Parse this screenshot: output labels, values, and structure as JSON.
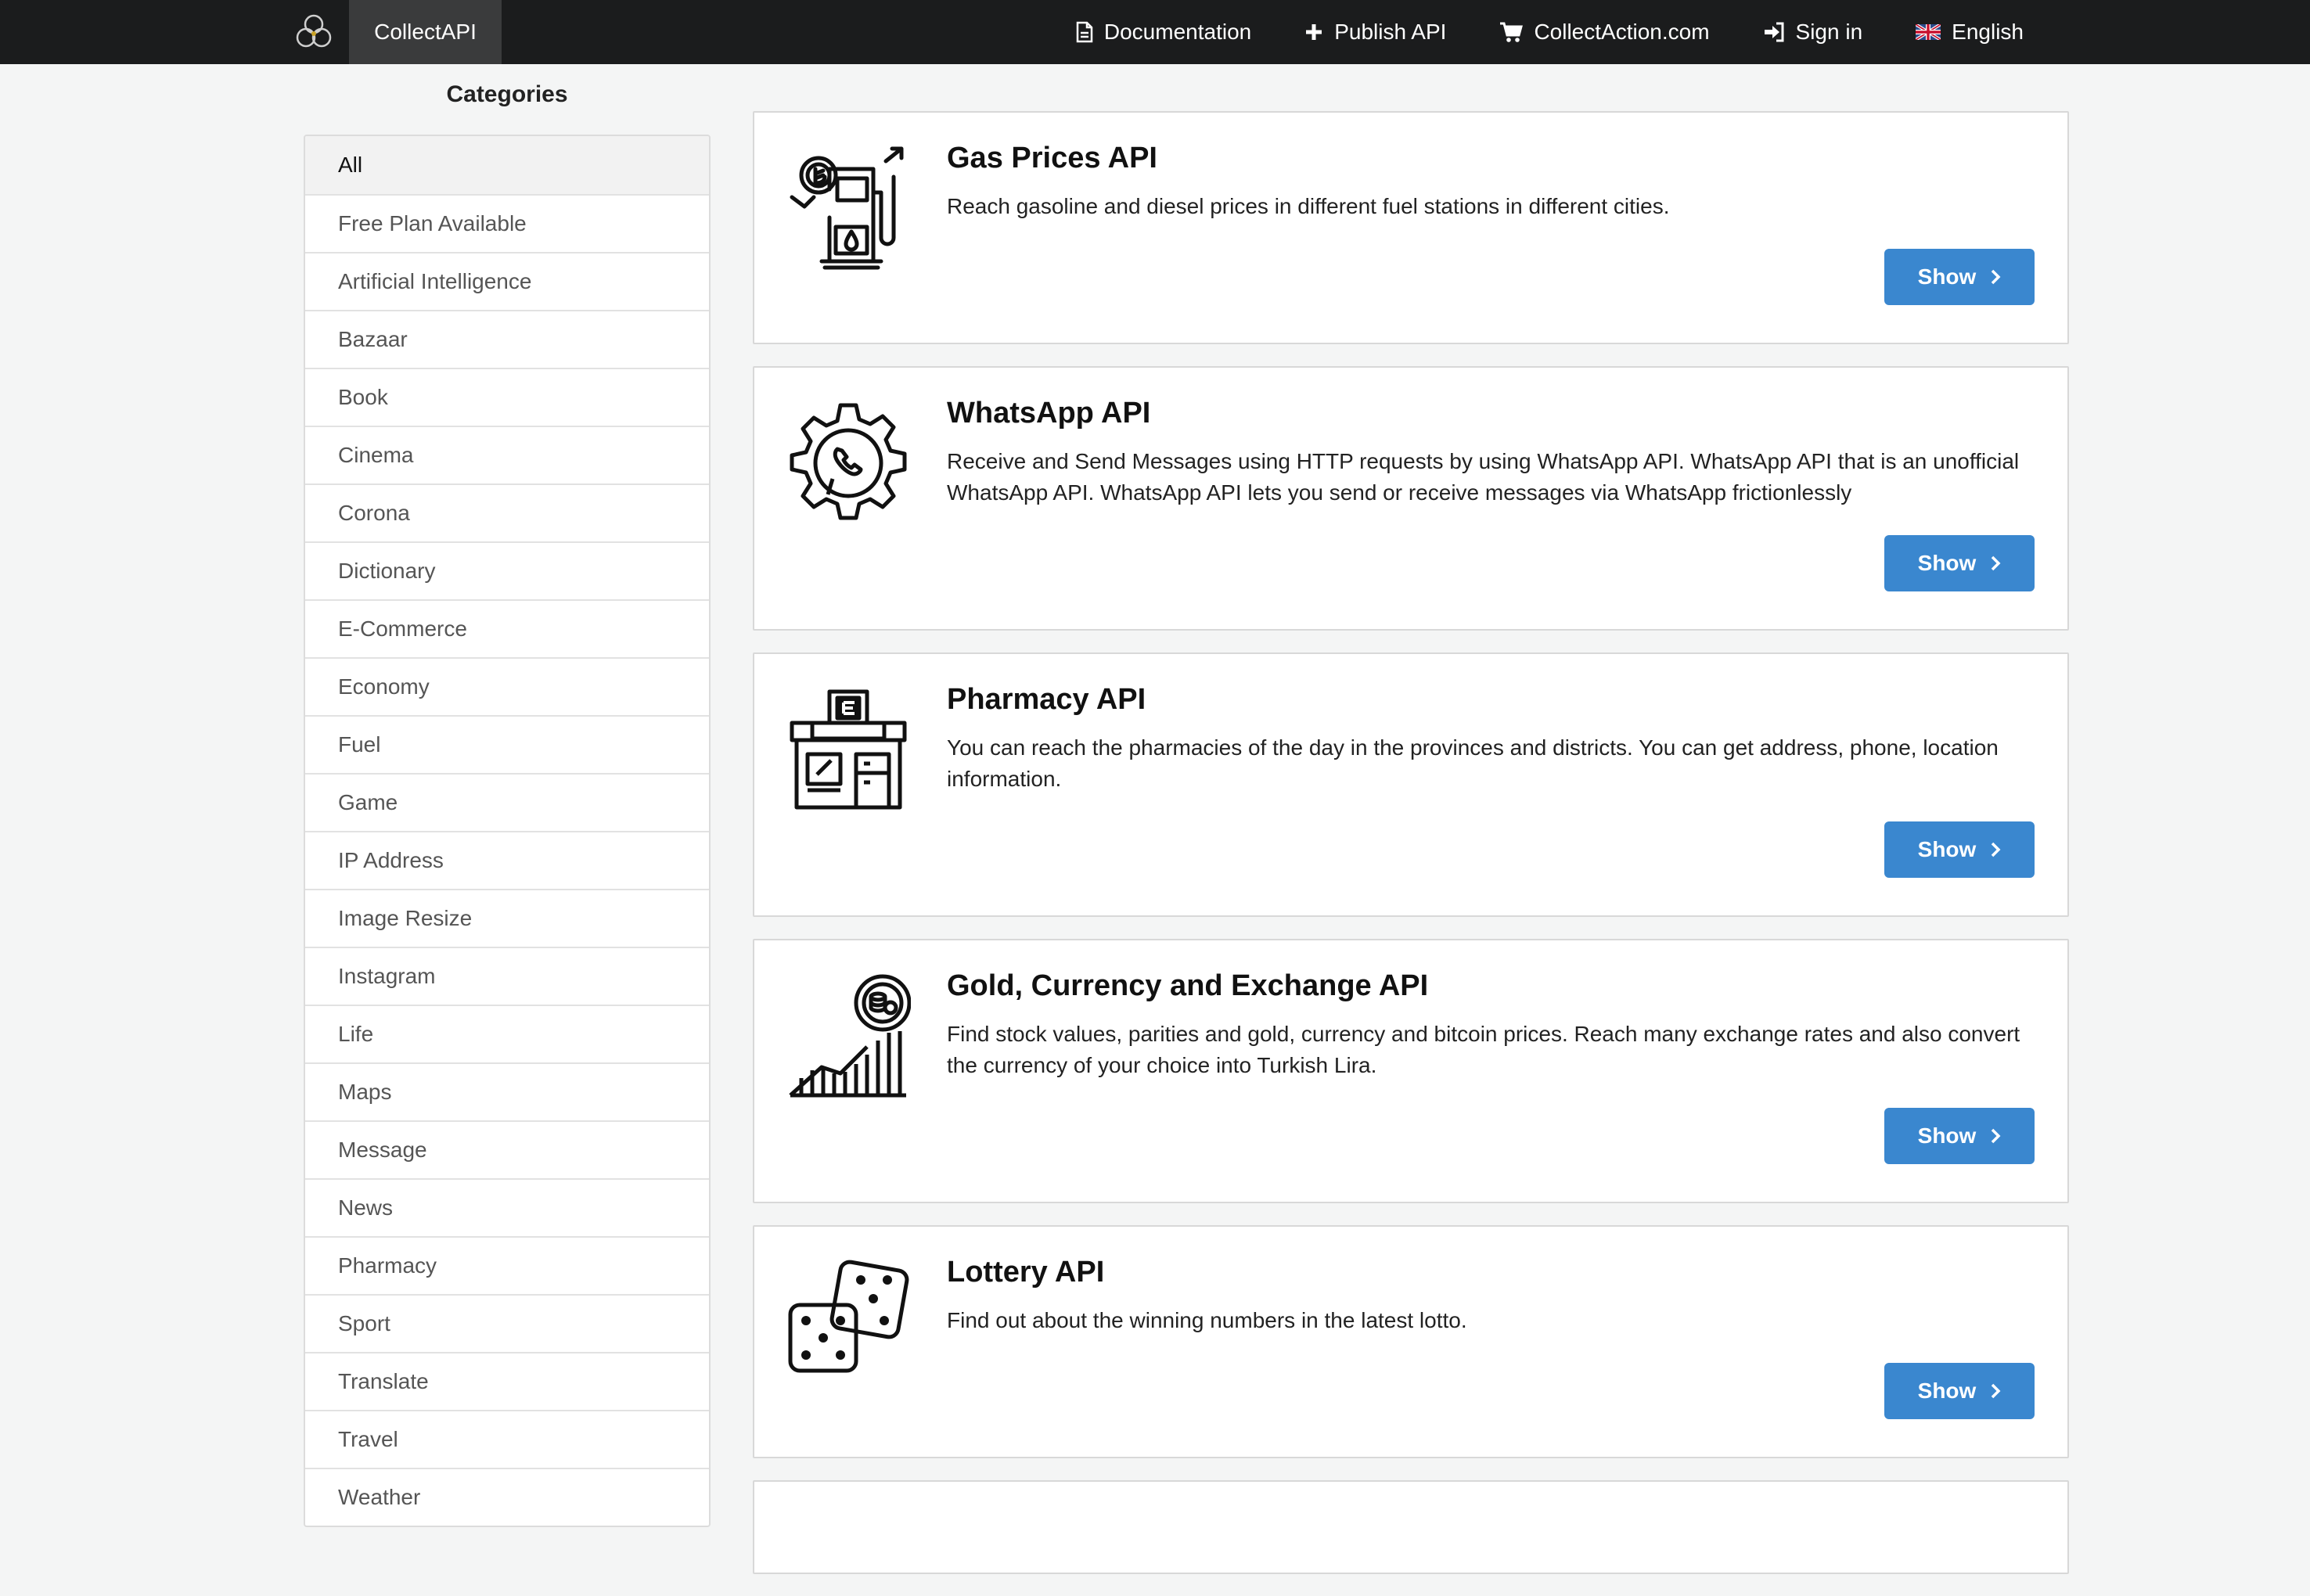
{
  "navbar": {
    "brand": "CollectAPI",
    "items": [
      {
        "label": "Documentation",
        "icon": "document-icon"
      },
      {
        "label": "Publish API",
        "icon": "plus-icon"
      },
      {
        "label": "CollectAction.com",
        "icon": "cart-icon"
      },
      {
        "label": "Sign in",
        "icon": "sign-in-icon"
      },
      {
        "label": "English",
        "icon": "uk-flag-icon"
      }
    ]
  },
  "sidebar": {
    "heading": "Categories",
    "items": [
      "All",
      "Free Plan Available",
      "Artificial Intelligence",
      "Bazaar",
      "Book",
      "Cinema",
      "Corona",
      "Dictionary",
      "E-Commerce",
      "Economy",
      "Fuel",
      "Game",
      "IP Address",
      "Image Resize",
      "Instagram",
      "Life",
      "Maps",
      "Message",
      "News",
      "Pharmacy",
      "Sport",
      "Translate",
      "Travel",
      "Weather"
    ]
  },
  "cards": [
    {
      "title": "Gas Prices API",
      "description": "Reach gasoline and diesel prices in different fuel stations in different cities.",
      "button": "Show",
      "icon": "gas-pump-icon"
    },
    {
      "title": "WhatsApp API",
      "description": "Receive and Send Messages using HTTP requests by using WhatsApp API. WhatsApp API that is an unofficial WhatsApp API.  WhatsApp API lets you send or receive messages via WhatsApp frictionlessly",
      "button": "Show",
      "icon": "whatsapp-gear-icon"
    },
    {
      "title": "Pharmacy API",
      "description": "You can reach the pharmacies of the day in the provinces and districts. You can get address, phone, location information.",
      "button": "Show",
      "icon": "pharmacy-building-icon"
    },
    {
      "title": "Gold, Currency and Exchange API",
      "description": "Find stock values, parities and gold, currency and bitcoin prices. Reach many exchange rates and also convert the currency of your choice into Turkish Lira.",
      "button": "Show",
      "icon": "currency-chart-icon"
    },
    {
      "title": "Lottery API",
      "description": "Find out about the winning numbers in the latest lotto.",
      "button": "Show",
      "icon": "dice-icon"
    }
  ],
  "colors": {
    "navbar": "#1b1c1d",
    "brand_bg": "#3a3b3c",
    "button": "#3a87cf",
    "page_bg": "#f4f5f5"
  }
}
